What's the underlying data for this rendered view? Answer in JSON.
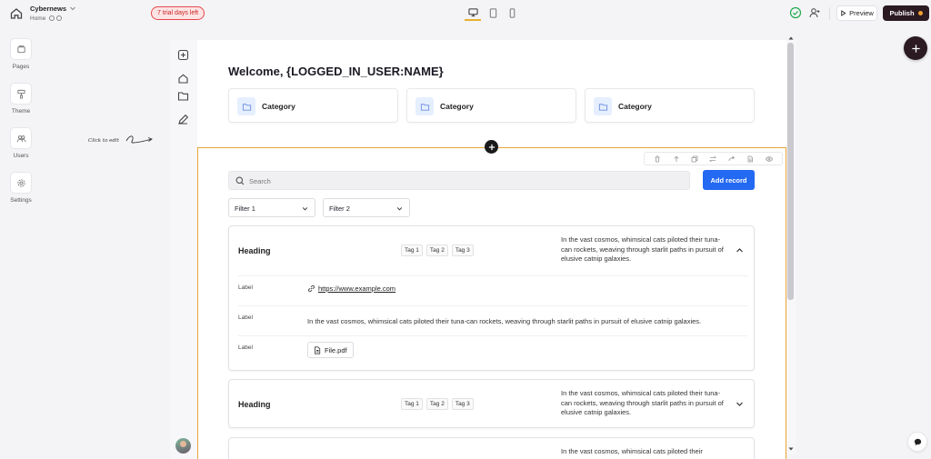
{
  "topbar": {
    "site_name": "Cybernews",
    "current_page": "Home",
    "trial_badge": "7 trial days left",
    "preview_label": "Preview",
    "publish_label": "Publish",
    "accent_color": "#2b1a22"
  },
  "sidebar": {
    "items": [
      {
        "label": "Pages",
        "icon": "pages-icon"
      },
      {
        "label": "Theme",
        "icon": "paint-roller-icon"
      },
      {
        "label": "Users",
        "icon": "users-icon"
      },
      {
        "label": "Settings",
        "icon": "gear-icon"
      }
    ],
    "hint": "Click to edit"
  },
  "page": {
    "welcome": "Welcome, {LOGGED_IN_USER:NAME}",
    "categories": [
      "Category",
      "Category",
      "Category"
    ],
    "search_placeholder": "Search",
    "add_record_label": "Add record",
    "add_record_color": "#2469f2",
    "filters": [
      "Filter 1",
      "Filter 2"
    ],
    "records": [
      {
        "heading": "Heading",
        "tags": [
          "Tag 1",
          "Tag 2",
          "Tag 3"
        ],
        "description": "In the vast cosmos, whimsical cats piloted their tuna-can rockets, weaving through starlit paths in pursuit of elusive catnip galaxies.",
        "expanded": true,
        "fields": [
          {
            "label": "Label",
            "link": "https://www.example.com"
          },
          {
            "label": "Label",
            "text": "In the vast cosmos, whimsical cats piloted their tuna-can rockets, weaving through starlit paths in pursuit of elusive catnip galaxies."
          },
          {
            "label": "Label",
            "file": "File.pdf"
          }
        ]
      },
      {
        "heading": "Heading",
        "tags": [
          "Tag 1",
          "Tag 2",
          "Tag 3"
        ],
        "description": "In the vast cosmos, whimsical cats piloted their tuna-can rockets, weaving through starlit paths in pursuit of elusive catnip galaxies.",
        "expanded": false
      },
      {
        "description": "In the vast cosmos, whimsical cats piloted their"
      }
    ]
  },
  "colors": {
    "selection_outline": "#e8a43a",
    "trial_badge": "#e5484d",
    "status_ok": "#20a84c"
  }
}
